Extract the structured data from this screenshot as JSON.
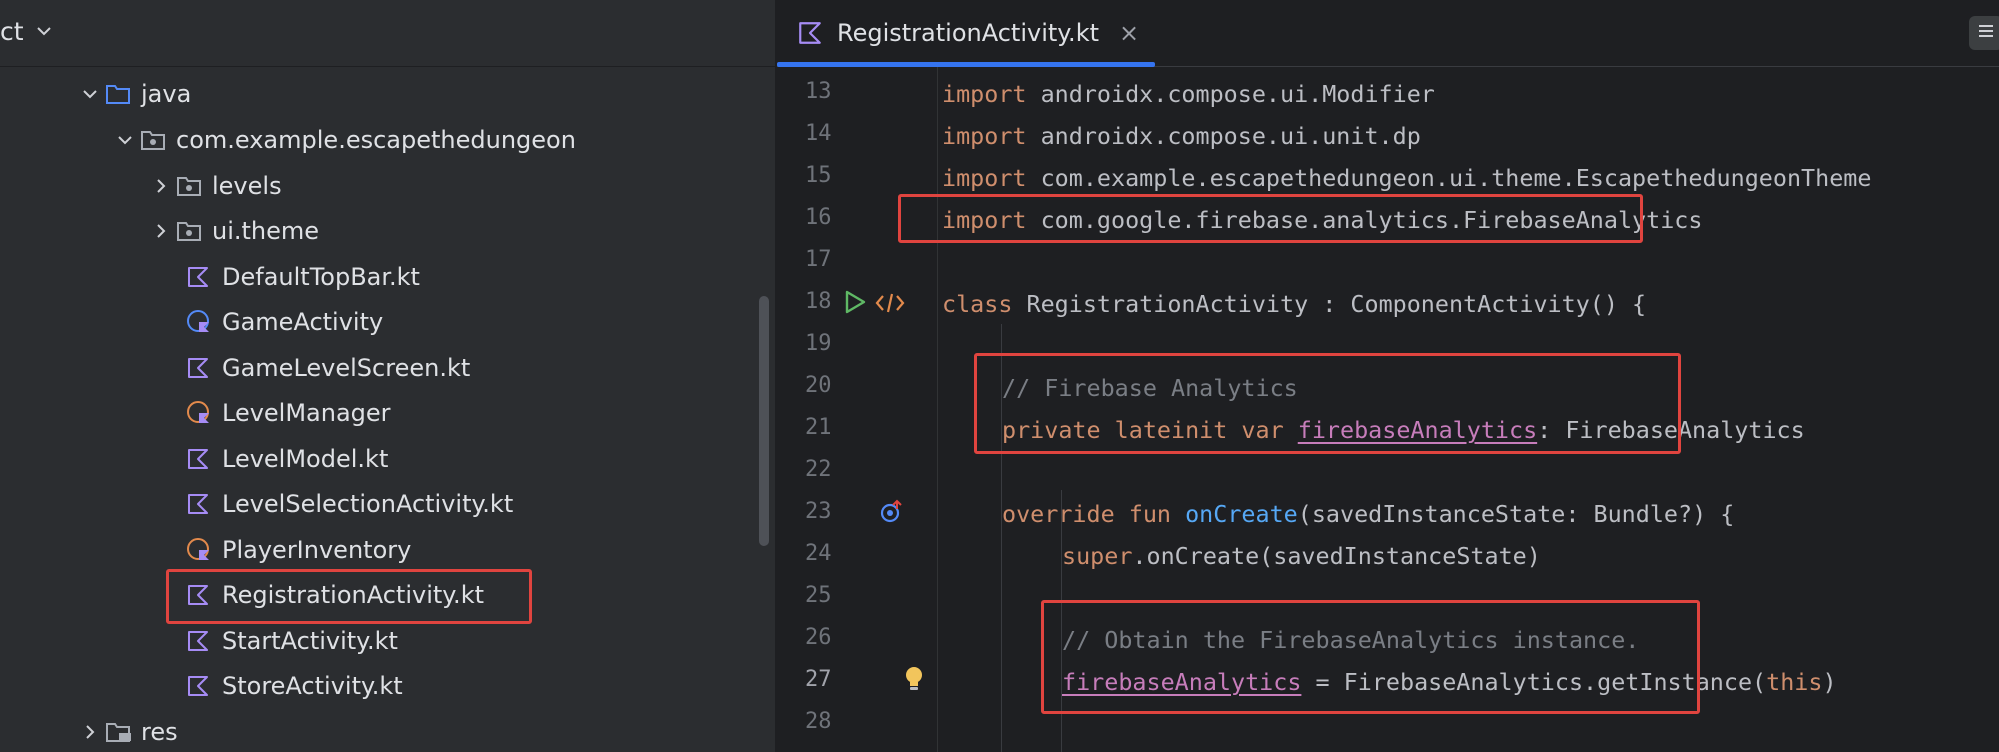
{
  "project": {
    "title": "ct",
    "tree": [
      {
        "label": "java",
        "kind": "folder",
        "expanded": true
      },
      {
        "label": "com.example.escapethedungeon",
        "kind": "package",
        "expanded": true
      },
      {
        "label": "levels",
        "kind": "package",
        "expanded": false
      },
      {
        "label": "ui.theme",
        "kind": "package",
        "expanded": false
      },
      {
        "label": "DefaultTopBar.kt",
        "kind": "kotlin-file"
      },
      {
        "label": "GameActivity",
        "kind": "kotlin-class"
      },
      {
        "label": "GameLevelScreen.kt",
        "kind": "kotlin-file"
      },
      {
        "label": "LevelManager",
        "kind": "kotlin-object"
      },
      {
        "label": "LevelModel.kt",
        "kind": "kotlin-file"
      },
      {
        "label": "LevelSelectionActivity.kt",
        "kind": "kotlin-file"
      },
      {
        "label": "PlayerInventory",
        "kind": "kotlin-object"
      },
      {
        "label": "RegistrationActivity.kt",
        "kind": "kotlin-file"
      },
      {
        "label": "StartActivity.kt",
        "kind": "kotlin-file"
      },
      {
        "label": "StoreActivity.kt",
        "kind": "kotlin-file"
      },
      {
        "label": "res",
        "kind": "res-folder",
        "expanded": false
      }
    ]
  },
  "editor": {
    "tab": {
      "label": "RegistrationActivity.kt",
      "close": "×"
    },
    "line_numbers": [
      "13",
      "14",
      "15",
      "16",
      "17",
      "18",
      "19",
      "20",
      "21",
      "22",
      "23",
      "24",
      "25",
      "26",
      "27",
      "28"
    ],
    "current_line": "27",
    "code": {
      "l13": {
        "kw": "import",
        "rest": " androidx.compose.ui.Modifier"
      },
      "l14": {
        "kw": "import",
        "rest": " androidx.compose.ui.unit.dp"
      },
      "l15": {
        "kw": "import",
        "rest": " com.example.escapethedungeon.ui.theme.EscapethedungeonTheme"
      },
      "l16": {
        "kw": "import",
        "rest": " com.google.firebase.analytics.FirebaseAnalytics"
      },
      "l18": {
        "kw": "class",
        "rest": " RegistrationActivity : ComponentActivity() {"
      },
      "l20": {
        "comment": "// Firebase Analytics"
      },
      "l21": {
        "kw": "private lateinit var",
        "prop": "firebaseAnalytics",
        "rest": ": FirebaseAnalytics"
      },
      "l23": {
        "kw": "override fun",
        "fn": "onCreate",
        "rest": "(savedInstanceState: Bundle?) {"
      },
      "l24": {
        "kw": "super",
        "rest": ".onCreate(savedInstanceState)"
      },
      "l26": {
        "comment": "// Obtain the FirebaseAnalytics instance."
      },
      "l27": {
        "prop": "firebaseAnalytics",
        "rest": " = FirebaseAnalytics.getInstance(",
        "kw": "this",
        "close": ")"
      }
    }
  },
  "colors": {
    "highlight_box": "#e0443f",
    "tab_underline": "#3574f0",
    "keyword": "#cf8e6d",
    "property": "#c77dbb",
    "function": "#56a8f5",
    "comment": "#7a7e85"
  }
}
